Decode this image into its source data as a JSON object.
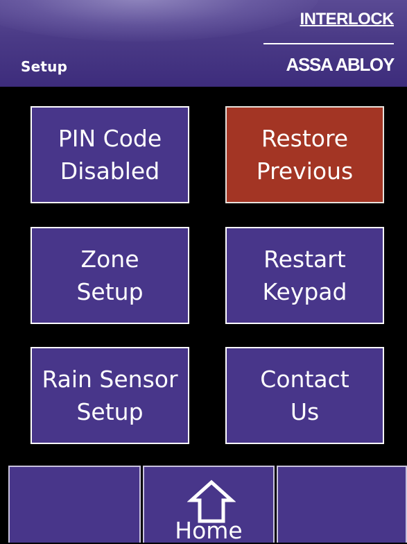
{
  "header": {
    "title": "Setup",
    "brand_top": "INTERLOCK",
    "brand_bottom": "ASSA ABLOY"
  },
  "tiles": [
    {
      "line1": "PIN Code",
      "line2": "Disabled"
    },
    {
      "line1": "Restore",
      "line2": "Previous"
    },
    {
      "line1": "Zone",
      "line2": "Setup"
    },
    {
      "line1": "Restart",
      "line2": "Keypad"
    },
    {
      "line1": "Rain Sensor",
      "line2": "Setup"
    },
    {
      "line1": "Contact",
      "line2": "Us"
    }
  ],
  "footer": {
    "left_label": "",
    "home_label": "Home",
    "right_label": ""
  },
  "colors": {
    "tile": "#48368a",
    "tile_active": "#a33524",
    "header": "#4a3a86",
    "background": "#000000"
  },
  "icons": {
    "home": "home-icon"
  }
}
